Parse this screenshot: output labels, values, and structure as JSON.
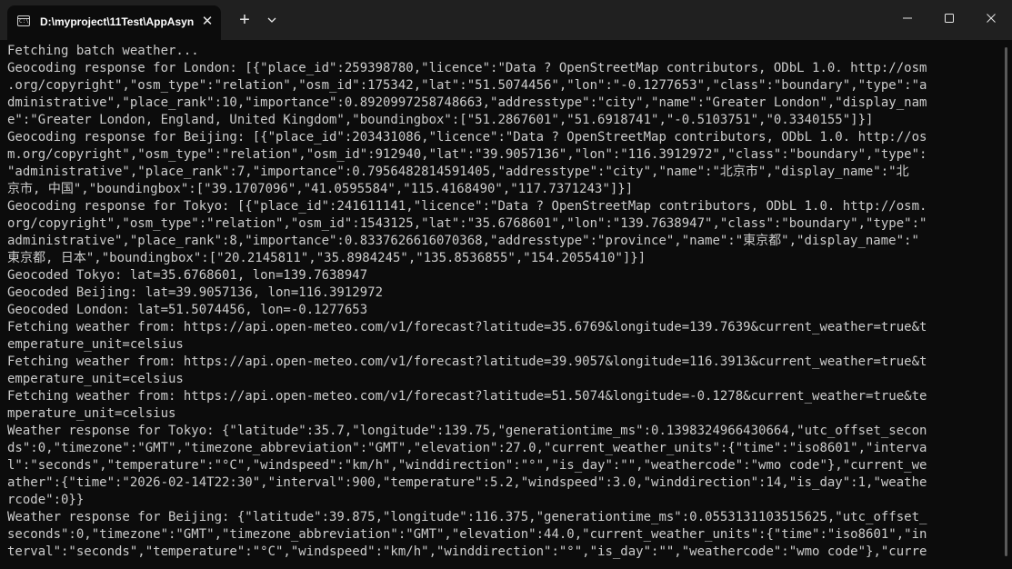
{
  "window": {
    "tab_title": "D:\\myproject\\11Test\\AppAsyn",
    "tab_icon_text": "C:\\",
    "close_tab_glyph": "✕",
    "new_tab_glyph": "+"
  },
  "icons": {
    "tab": "terminal-icon",
    "close_tab": "close-icon",
    "new_tab": "plus-icon",
    "dropdown": "chevron-down-icon",
    "minimize": "minimize-icon",
    "maximize": "maximize-icon",
    "close_window": "close-icon"
  },
  "colors": {
    "background": "#0c0c0c",
    "titlebar": "#202020",
    "text": "#cccccc"
  },
  "console": {
    "lines": [
      "Fetching batch weather...",
      "Geocoding response for London: [{\"place_id\":259398780,\"licence\":\"Data ? OpenStreetMap contributors, ODbL 1.0. http://osm",
      ".org/copyright\",\"osm_type\":\"relation\",\"osm_id\":175342,\"lat\":\"51.5074456\",\"lon\":\"-0.1277653\",\"class\":\"boundary\",\"type\":\"a",
      "dministrative\",\"place_rank\":10,\"importance\":0.8920997258748663,\"addresstype\":\"city\",\"name\":\"Greater London\",\"display_nam",
      "e\":\"Greater London, England, United Kingdom\",\"boundingbox\":[\"51.2867601\",\"51.6918741\",\"-0.5103751\",\"0.3340155\"]}]",
      "Geocoding response for Beijing: [{\"place_id\":203431086,\"licence\":\"Data ? OpenStreetMap contributors, ODbL 1.0. http://os",
      "m.org/copyright\",\"osm_type\":\"relation\",\"osm_id\":912940,\"lat\":\"39.9057136\",\"lon\":\"116.3912972\",\"class\":\"boundary\",\"type\":",
      "\"administrative\",\"place_rank\":7,\"importance\":0.7956482814591405,\"addresstype\":\"city\",\"name\":\"北京市\",\"display_name\":\"北",
      "京市, 中国\",\"boundingbox\":[\"39.1707096\",\"41.0595584\",\"115.4168490\",\"117.7371243\"]}]",
      "Geocoding response for Tokyo: [{\"place_id\":241611141,\"licence\":\"Data ? OpenStreetMap contributors, ODbL 1.0. http://osm.",
      "org/copyright\",\"osm_type\":\"relation\",\"osm_id\":1543125,\"lat\":\"35.6768601\",\"lon\":\"139.7638947\",\"class\":\"boundary\",\"type\":\"",
      "administrative\",\"place_rank\":8,\"importance\":0.8337626616070368,\"addresstype\":\"province\",\"name\":\"東京都\",\"display_name\":\"",
      "東京都, 日本\",\"boundingbox\":[\"20.2145811\",\"35.8984245\",\"135.8536855\",\"154.2055410\"]}]",
      "Geocoded Tokyo: lat=35.6768601, lon=139.7638947",
      "Geocoded Beijing: lat=39.9057136, lon=116.3912972",
      "Geocoded London: lat=51.5074456, lon=-0.1277653",
      "Fetching weather from: https://api.open-meteo.com/v1/forecast?latitude=35.6769&longitude=139.7639&current_weather=true&t",
      "emperature_unit=celsius",
      "Fetching weather from: https://api.open-meteo.com/v1/forecast?latitude=39.9057&longitude=116.3913&current_weather=true&t",
      "emperature_unit=celsius",
      "Fetching weather from: https://api.open-meteo.com/v1/forecast?latitude=51.5074&longitude=-0.1278&current_weather=true&te",
      "mperature_unit=celsius",
      "Weather response for Tokyo: {\"latitude\":35.7,\"longitude\":139.75,\"generationtime_ms\":0.1398324966430664,\"utc_offset_secon",
      "ds\":0,\"timezone\":\"GMT\",\"timezone_abbreviation\":\"GMT\",\"elevation\":27.0,\"current_weather_units\":{\"time\":\"iso8601\",\"interva",
      "l\":\"seconds\",\"temperature\":\"°C\",\"windspeed\":\"km/h\",\"winddirection\":\"°\",\"is_day\":\"\",\"weathercode\":\"wmo code\"},\"current_we",
      "ather\":{\"time\":\"2026-02-14T22:30\",\"interval\":900,\"temperature\":5.2,\"windspeed\":3.0,\"winddirection\":14,\"is_day\":1,\"weathe",
      "rcode\":0}}",
      "Weather response for Beijing: {\"latitude\":39.875,\"longitude\":116.375,\"generationtime_ms\":0.0553131103515625,\"utc_offset_",
      "seconds\":0,\"timezone\":\"GMT\",\"timezone_abbreviation\":\"GMT\",\"elevation\":44.0,\"current_weather_units\":{\"time\":\"iso8601\",\"in",
      "terval\":\"seconds\",\"temperature\":\"°C\",\"windspeed\":\"km/h\",\"winddirection\":\"°\",\"is_day\":\"\",\"weathercode\":\"wmo code\"},\"curre"
    ]
  }
}
